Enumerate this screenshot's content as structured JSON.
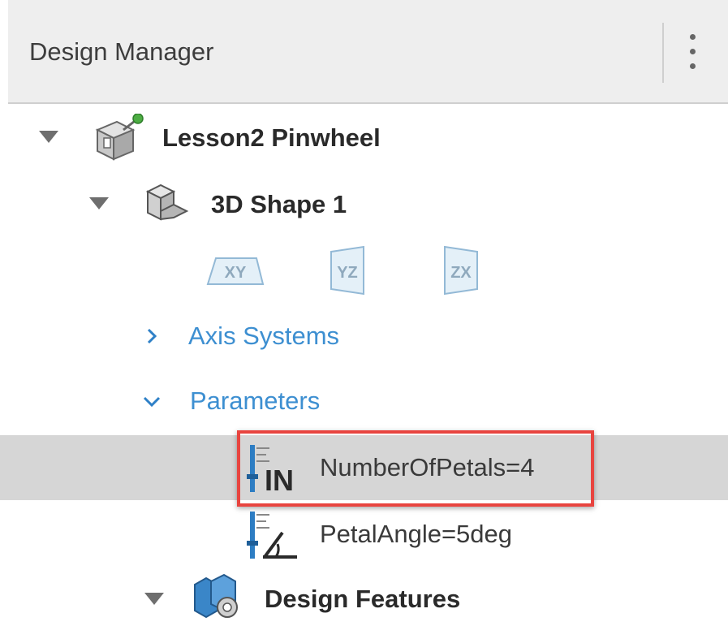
{
  "header": {
    "title": "Design Manager",
    "menu_icon": "more-vertical-icon"
  },
  "tree": {
    "root": {
      "label": "Lesson2 Pinwheel",
      "icon": "product-icon",
      "expanded": true
    },
    "shape": {
      "label": "3D Shape 1",
      "icon": "3d-shape-icon",
      "expanded": true
    },
    "planes": [
      {
        "label": "XY",
        "icon": "xy-plane-icon"
      },
      {
        "label": "YZ",
        "icon": "yz-plane-icon"
      },
      {
        "label": "ZX",
        "icon": "zx-plane-icon"
      }
    ],
    "axis_systems": {
      "label": "Axis Systems",
      "expanded": false
    },
    "parameters": {
      "label": "Parameters",
      "expanded": true,
      "items": [
        {
          "label": "NumberOfPetals=4",
          "icon": "integer-parameter-icon",
          "icon_text": "IN",
          "selected": true
        },
        {
          "label": "PetalAngle=5deg",
          "icon": "angle-parameter-icon",
          "selected": false
        }
      ]
    },
    "design_features": {
      "label": "Design Features",
      "icon": "design-features-icon",
      "expanded": true
    }
  },
  "colors": {
    "link": "#3d8fd1",
    "highlight": "#e8443f",
    "selected_row": "#d6d6d6",
    "header_bg": "#eeeeee"
  }
}
